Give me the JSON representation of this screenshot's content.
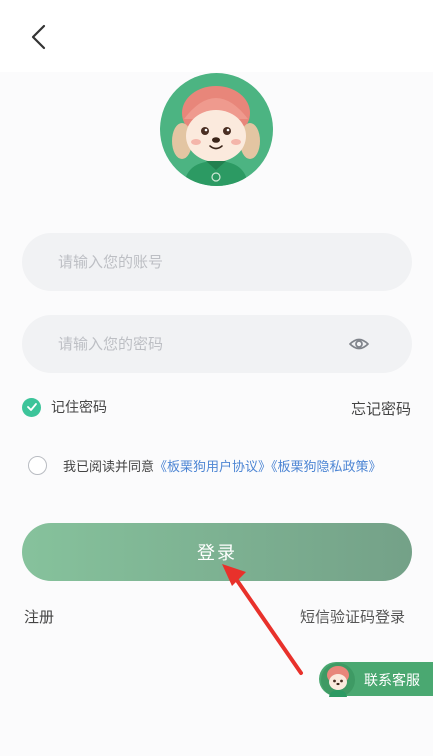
{
  "header": {
    "back_icon": "chevron-left-icon"
  },
  "avatar": {
    "icon": "puppy-mascot-avatar",
    "bg_color": "#4cb482"
  },
  "account_field": {
    "placeholder": "请输入您的账号",
    "value": ""
  },
  "password_field": {
    "placeholder": "请输入您的密码",
    "value": "",
    "toggle_icon": "eye-icon"
  },
  "remember": {
    "label": "记住密码",
    "checked": true,
    "color": "#3cc49a"
  },
  "forgot_label": "忘记密码",
  "agreement": {
    "prefix": "我已阅读并同意",
    "user_agreement": "《板栗狗用户协议》",
    "privacy_policy": "《板栗狗隐私政策》",
    "checked": false,
    "link_color": "#4e86d4"
  },
  "login_label": "登录",
  "register_label": "注册",
  "sms_login_label": "短信验证码登录",
  "support": {
    "label": "联系客服",
    "icon": "puppy-mascot-icon",
    "color": "#4aa871"
  }
}
